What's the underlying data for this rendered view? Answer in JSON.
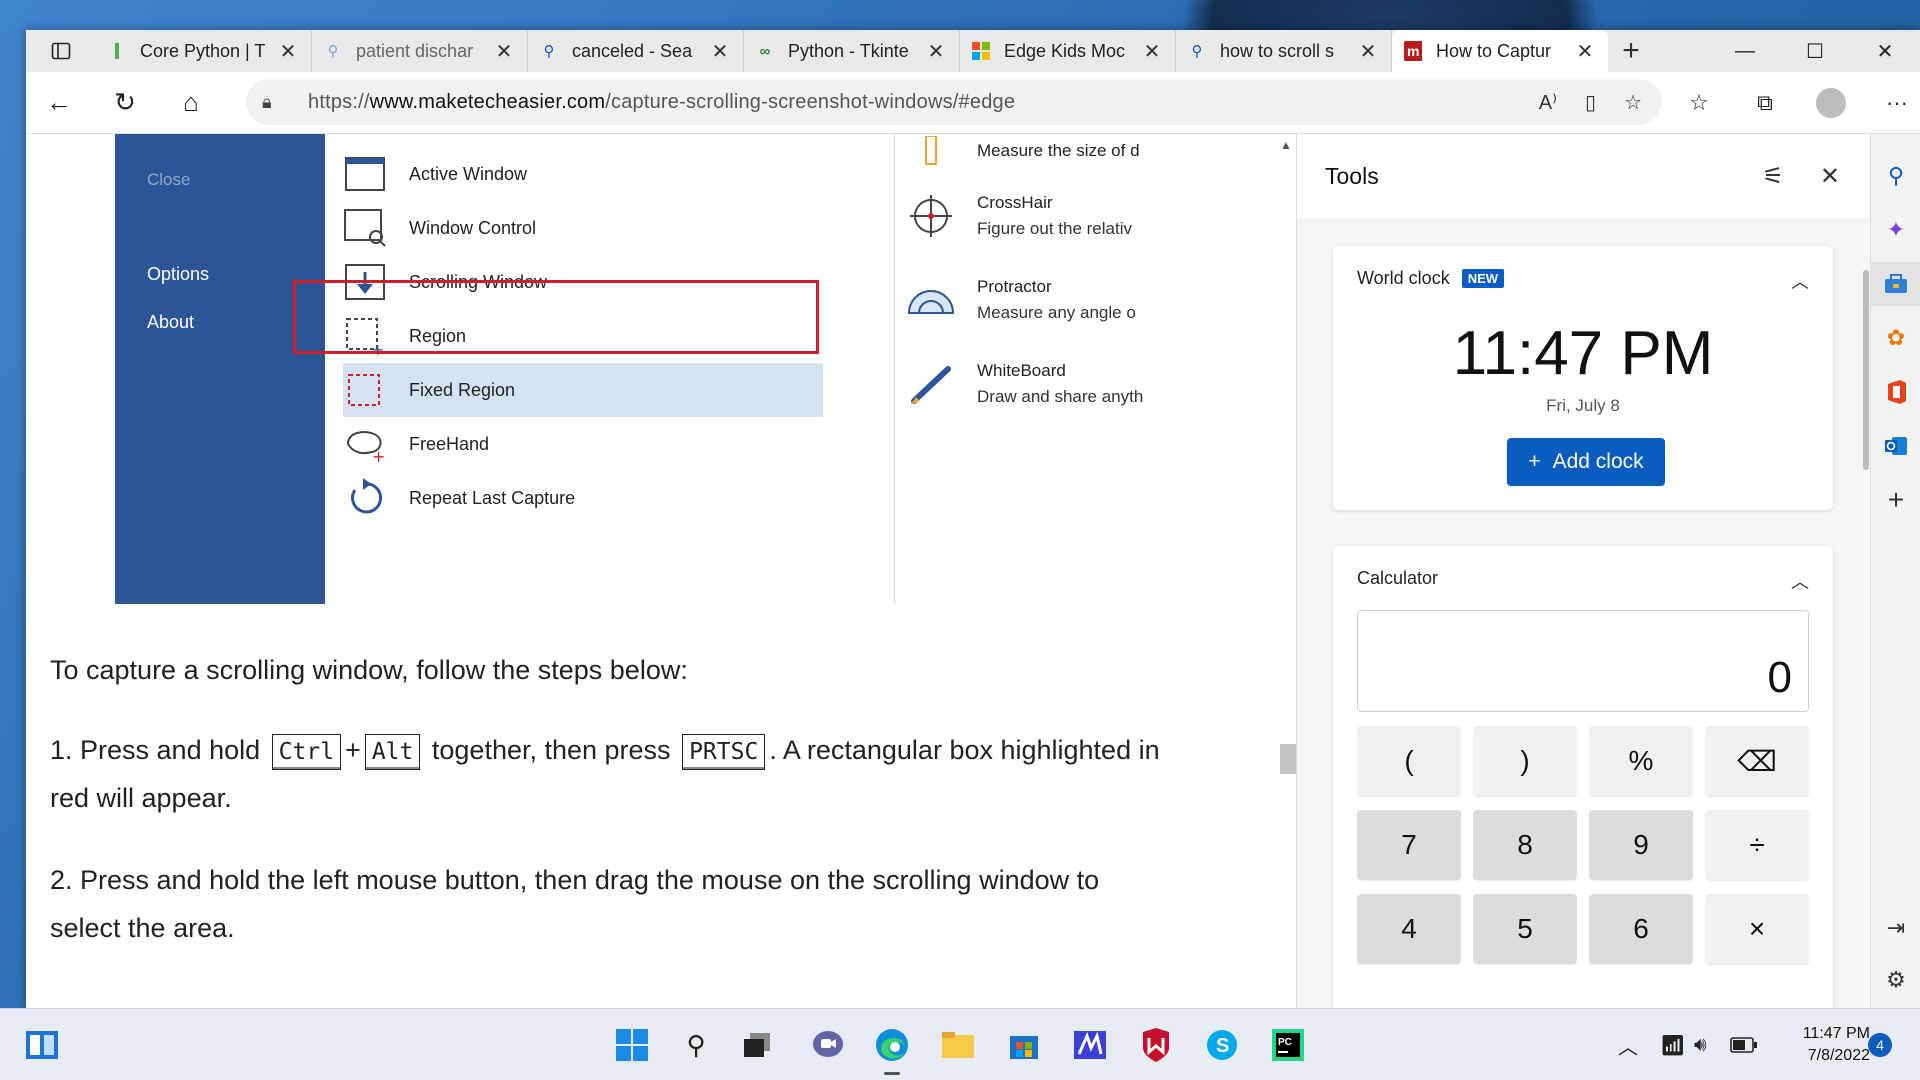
{
  "browser": {
    "tabs": [
      {
        "label": "Core Python | T",
        "icon": "green-bar-icon"
      },
      {
        "label": "patient dischar",
        "icon": "search-icon"
      },
      {
        "label": "canceled - Sea",
        "icon": "search-icon"
      },
      {
        "label": "Python - Tkinte",
        "icon": "python-icon"
      },
      {
        "label": "Edge Kids Moc",
        "icon": "microsoft-icon"
      },
      {
        "label": "how to scroll s",
        "icon": "search-icon"
      },
      {
        "label": "How to Captur",
        "icon": "mte-icon",
        "active": true
      }
    ],
    "url_prefix": "https://",
    "url_domain": "www.maketecheasier.com",
    "url_path": "/capture-scrolling-screenshot-windows/#edge"
  },
  "screenshot": {
    "sidebar": {
      "close": "Close",
      "options": "Options",
      "about": "About"
    },
    "modes": [
      "Active Window",
      "Window Control",
      "Scrolling Window",
      "Region",
      "Fixed Region",
      "FreeHand",
      "Repeat Last Capture"
    ],
    "tools": [
      {
        "name": "Measure the size of d",
        "desc": ""
      },
      {
        "name": "CrossHair",
        "desc": "Figure out the relativ"
      },
      {
        "name": "Protractor",
        "desc": "Measure any angle o"
      },
      {
        "name": "WhiteBoard",
        "desc": "Draw and share anyth"
      }
    ]
  },
  "article": {
    "intro": "To capture a scrolling window, follow the steps below:",
    "step1_a": "1. Press and hold",
    "key_ctrl": "Ctrl",
    "plus": "+",
    "key_alt": "Alt",
    "step1_b": "together, then press",
    "key_prtsc": "PRTSC",
    "step1_c": ". A rectangular box highlighted in",
    "step1_d": "red will appear.",
    "step2_a": "2. Press and hold the left mouse button, then drag the mouse on the scrolling window to",
    "step2_b": "select the area."
  },
  "tools_panel": {
    "title": "Tools",
    "world_clock": {
      "title": "World clock",
      "badge": "NEW",
      "time": "11:47 PM",
      "date": "Fri, July 8",
      "add_button": "Add clock"
    },
    "calculator": {
      "title": "Calculator",
      "display": "0",
      "keys": [
        "(",
        ")",
        "%",
        "⌫",
        "7",
        "8",
        "9",
        "÷",
        "4",
        "5",
        "6",
        "×"
      ]
    }
  },
  "taskbar": {
    "time": "11:47 PM",
    "date": "7/8/2022",
    "notifications": "4"
  },
  "colors": {
    "accent": "#0b5cbf",
    "highlight_red": "#d41e27",
    "snag_blue": "#2c5597"
  }
}
